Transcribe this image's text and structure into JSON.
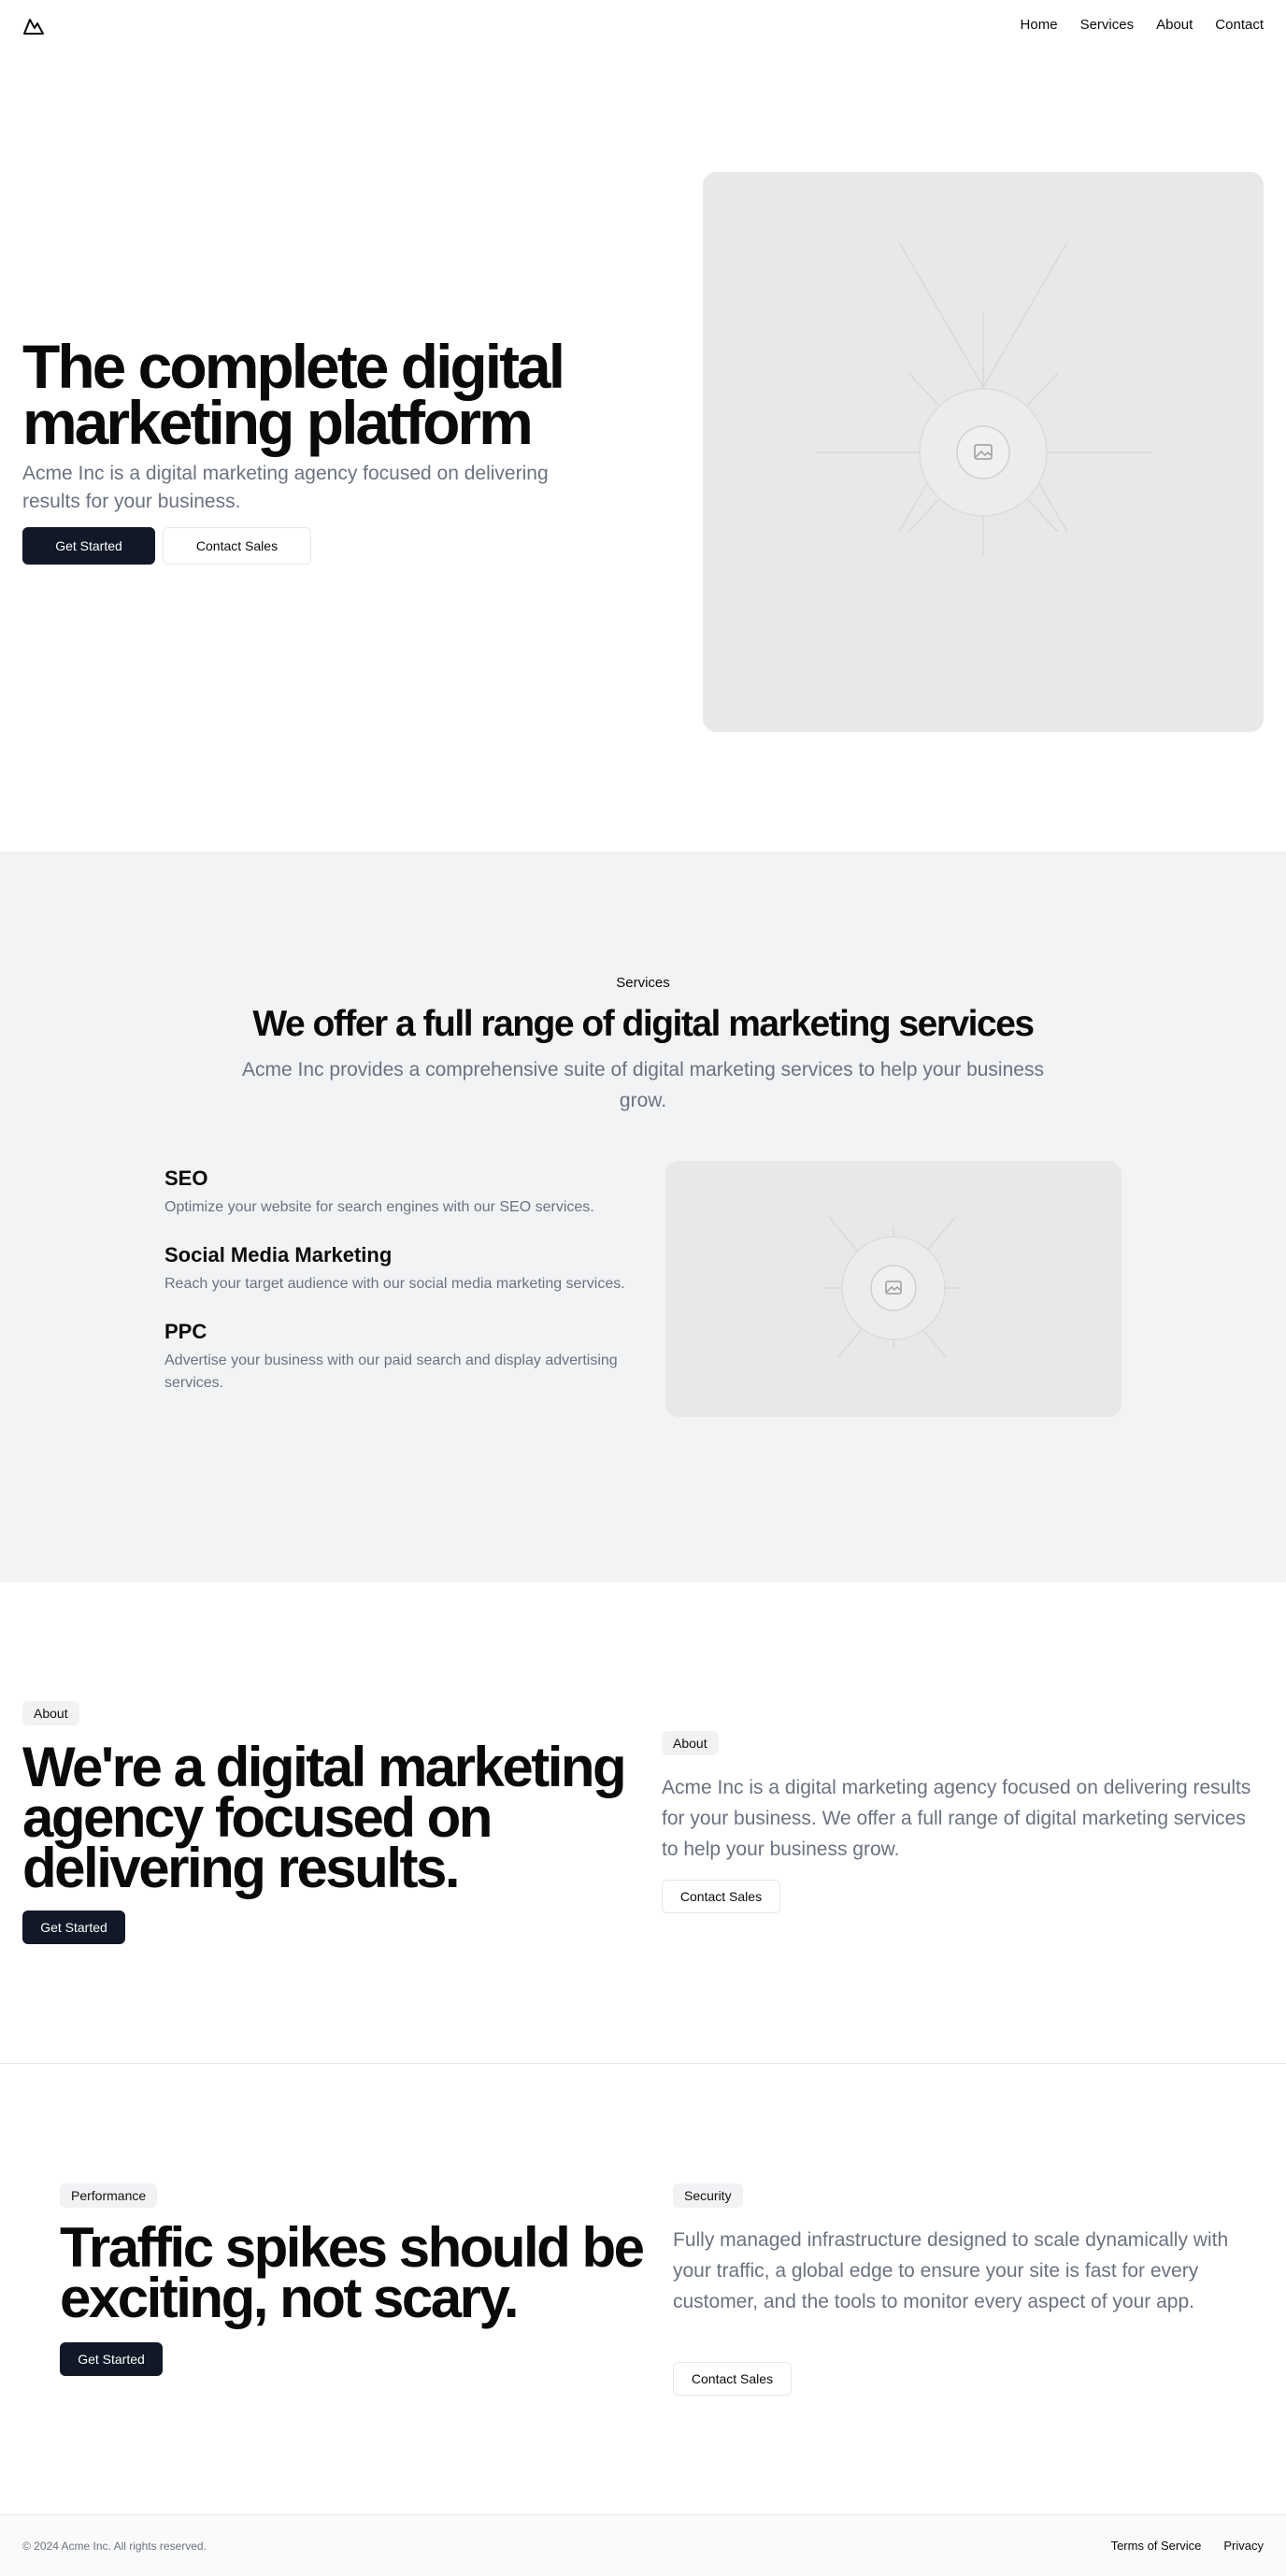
{
  "header": {
    "nav": [
      "Home",
      "Services",
      "About",
      "Contact"
    ]
  },
  "hero": {
    "title_line1": "The complete digital",
    "title_line2": "marketing platform",
    "subtitle": "Acme Inc is a digital marketing agency focused on delivering results for your business.",
    "primary_cta": "Get Started",
    "secondary_cta": "Contact Sales"
  },
  "services": {
    "eyebrow": "Services",
    "title": "We offer a full range of digital marketing services",
    "subtitle": "Acme Inc provides a comprehensive suite of digital marketing services to help your business grow.",
    "items": [
      {
        "title": "SEO",
        "desc": "Optimize your website for search engines with our SEO services."
      },
      {
        "title": "Social Media Marketing",
        "desc": "Reach your target audience with our social media marketing services."
      },
      {
        "title": "PPC",
        "desc": "Advertise your business with our paid search and display advertising services."
      }
    ]
  },
  "about": {
    "badge_left": "About",
    "title_line1": "We're a digital marketing",
    "title_line2": "agency focused on",
    "title_line3": "delivering results.",
    "primary_cta": "Get Started",
    "badge_right": "About",
    "body": "Acme Inc is a digital marketing agency focused on delivering results for your business. We offer a full range of digital marketing services to help your business grow.",
    "secondary_cta": "Contact Sales"
  },
  "performance": {
    "badge": "Performance",
    "title_line1": "Traffic spikes should be",
    "title_line2": "exciting, not scary.",
    "cta": "Get Started"
  },
  "security": {
    "badge": "Security",
    "body": "Fully managed infrastructure designed to scale dynamically with your traffic, a global edge to ensure your site is fast for every customer, and the tools to monitor every aspect of your app.",
    "cta": "Contact Sales"
  },
  "footer": {
    "copyright": "© 2024 Acme Inc. All rights reserved.",
    "links": [
      "Terms of Service",
      "Privacy"
    ]
  }
}
